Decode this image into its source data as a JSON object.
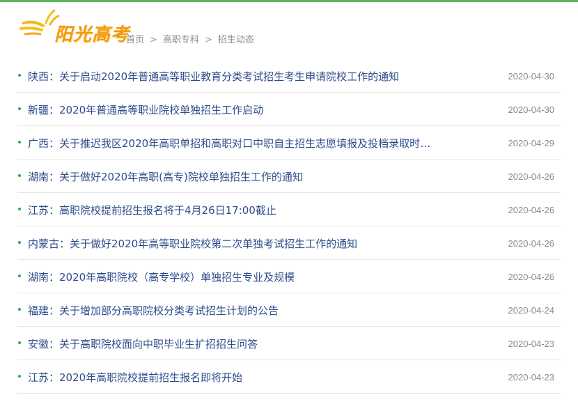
{
  "logo": {
    "text": "阳光高考"
  },
  "breadcrumb": {
    "items": [
      "首页",
      "高职专科",
      "招生动态"
    ],
    "separator": ">"
  },
  "colors": {
    "accent_bar": "#5cb85c",
    "link": "#2d4c8c",
    "bullet": "#2aa57a",
    "logo": "#f29a16"
  },
  "news": [
    {
      "title": "陕西：关于启动2020年普通高等职业教育分类考试招生考生申请院校工作的通知",
      "date": "2020-04-30"
    },
    {
      "title": "新疆：2020年普通高等职业院校单独招生工作启动",
      "date": "2020-04-30"
    },
    {
      "title": "广西：关于推迟我区2020年高职单招和高职对口中职自主招生志愿填报及投档录取时间...",
      "date": "2020-04-29"
    },
    {
      "title": "湖南：关于做好2020年高职(高专)院校单独招生工作的通知",
      "date": "2020-04-26"
    },
    {
      "title": "江苏：高职院校提前招生报名将于4月26日17:00截止",
      "date": "2020-04-26"
    },
    {
      "title": "内蒙古：关于做好2020年高等职业院校第二次单独考试招生工作的通知",
      "date": "2020-04-26"
    },
    {
      "title": "湖南：2020年高职院校（高专学校）单独招生专业及规模",
      "date": "2020-04-26"
    },
    {
      "title": "福建：关于增加部分高职院校分类考试招生计划的公告",
      "date": "2020-04-24"
    },
    {
      "title": "安徽：关于高职院校面向中职毕业生扩招招生问答",
      "date": "2020-04-23"
    },
    {
      "title": "江苏：2020年高职院校提前招生报名即将开始",
      "date": "2020-04-23"
    }
  ]
}
